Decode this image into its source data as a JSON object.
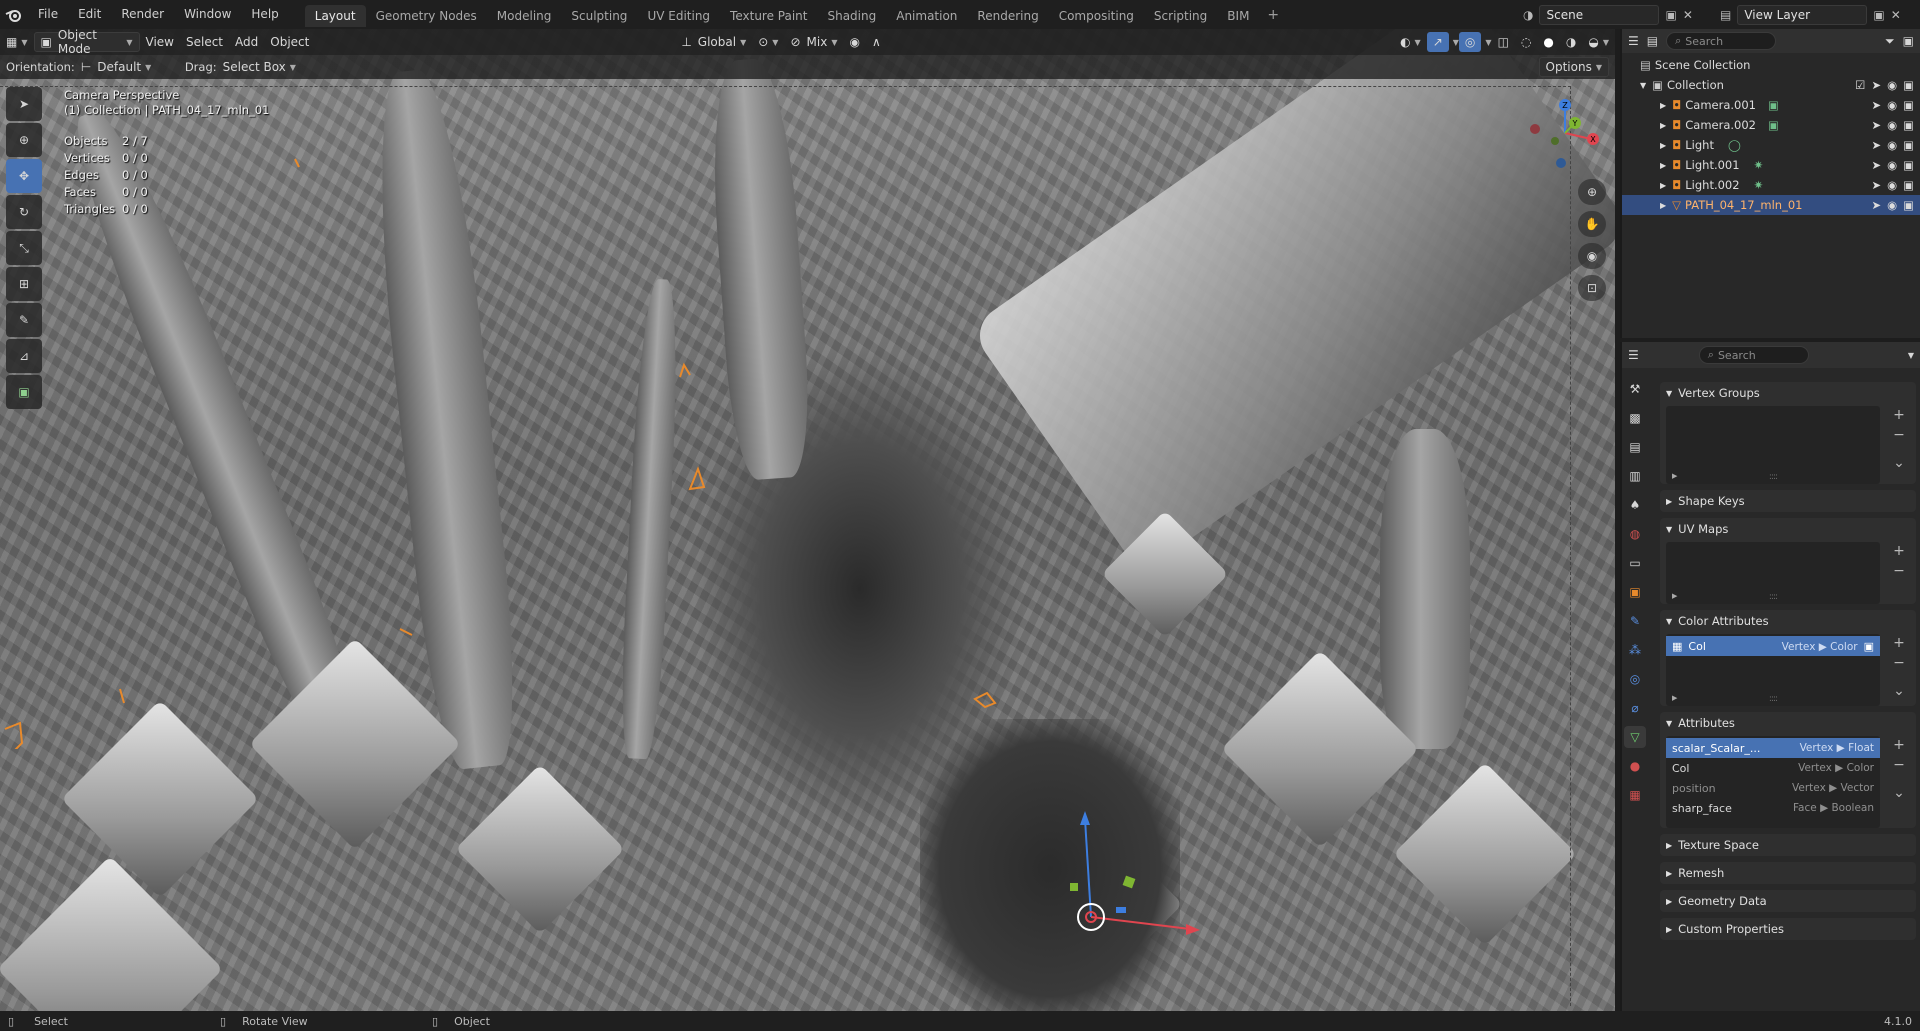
{
  "topbar": {
    "menus": [
      "File",
      "Edit",
      "Render",
      "Window",
      "Help"
    ],
    "workspaces": [
      "Layout",
      "Geometry Nodes",
      "Modeling",
      "Sculpting",
      "UV Editing",
      "Texture Paint",
      "Shading",
      "Animation",
      "Rendering",
      "Compositing",
      "Scripting",
      "BIM"
    ],
    "active_workspace": "Layout",
    "add_label": "+",
    "scene": "Scene",
    "view_layer": "View Layer"
  },
  "viewport": {
    "mode": "Object Mode",
    "menus": [
      "View",
      "Select",
      "Add",
      "Object"
    ],
    "transform_orientation": "Global",
    "snap_mode": "Mix",
    "orientation_label": "Orientation:",
    "orientation_value": "Default",
    "drag_label": "Drag:",
    "drag_value": "Select Box",
    "options_label": "Options",
    "camera_title": "Camera Perspective",
    "collection_line": "(1) Collection | PATH_04_17_mln_01",
    "stats": [
      {
        "k": "Objects",
        "v": "2 / 7"
      },
      {
        "k": "Vertices",
        "v": "0 / 0"
      },
      {
        "k": "Edges",
        "v": "0 / 0"
      },
      {
        "k": "Faces",
        "v": "0 / 0"
      },
      {
        "k": "Triangles",
        "v": "0 / 0"
      }
    ],
    "gizmo_axes": {
      "x": "X",
      "y": "Y",
      "z": "Z"
    }
  },
  "outliner": {
    "search_placeholder": "Search",
    "scene_collection": "Scene Collection",
    "collection": "Collection",
    "items": [
      {
        "name": "Camera.001",
        "icon": "camera-icon",
        "selected": false
      },
      {
        "name": "Camera.002",
        "icon": "camera-icon",
        "selected": false
      },
      {
        "name": "Light",
        "icon": "light-icon",
        "selected": false
      },
      {
        "name": "Light.001",
        "icon": "light-icon",
        "selected": false
      },
      {
        "name": "Light.002",
        "icon": "light-icon",
        "selected": false
      },
      {
        "name": "PATH_04_17_mln_01",
        "icon": "mesh-icon",
        "selected": true
      }
    ]
  },
  "properties": {
    "search_placeholder": "Search",
    "panels": {
      "vertex_groups": "Vertex Groups",
      "shape_keys": "Shape Keys",
      "uv_maps": "UV Maps",
      "color_attributes": "Color Attributes",
      "attributes": "Attributes",
      "texture_space": "Texture Space",
      "remesh": "Remesh",
      "geometry_data": "Geometry Data",
      "custom_properties": "Custom Properties"
    },
    "color_attrs": [
      {
        "name": "Col",
        "domain": "Vertex ▶ Color"
      }
    ],
    "attributes": [
      {
        "name": "scalar_Scalar_...",
        "domain": "Vertex ▶ Float",
        "selected": true
      },
      {
        "name": "Col",
        "domain": "Vertex ▶ Color",
        "selected": false
      },
      {
        "name": "position",
        "domain": "Vertex ▶ Vector",
        "selected": false
      },
      {
        "name": "sharp_face",
        "domain": "Face ▶ Boolean",
        "selected": false
      }
    ]
  },
  "statusbar": {
    "select": "Select",
    "rotate": "Rotate View",
    "object": "Object",
    "version": "4.1.0"
  },
  "colors": {
    "accent": "#4772b3",
    "selected_row": "#334d80",
    "orange": "#e88a2c",
    "x_axis": "#e0454f",
    "y_axis": "#7fb632",
    "z_axis": "#3d7ee0"
  }
}
